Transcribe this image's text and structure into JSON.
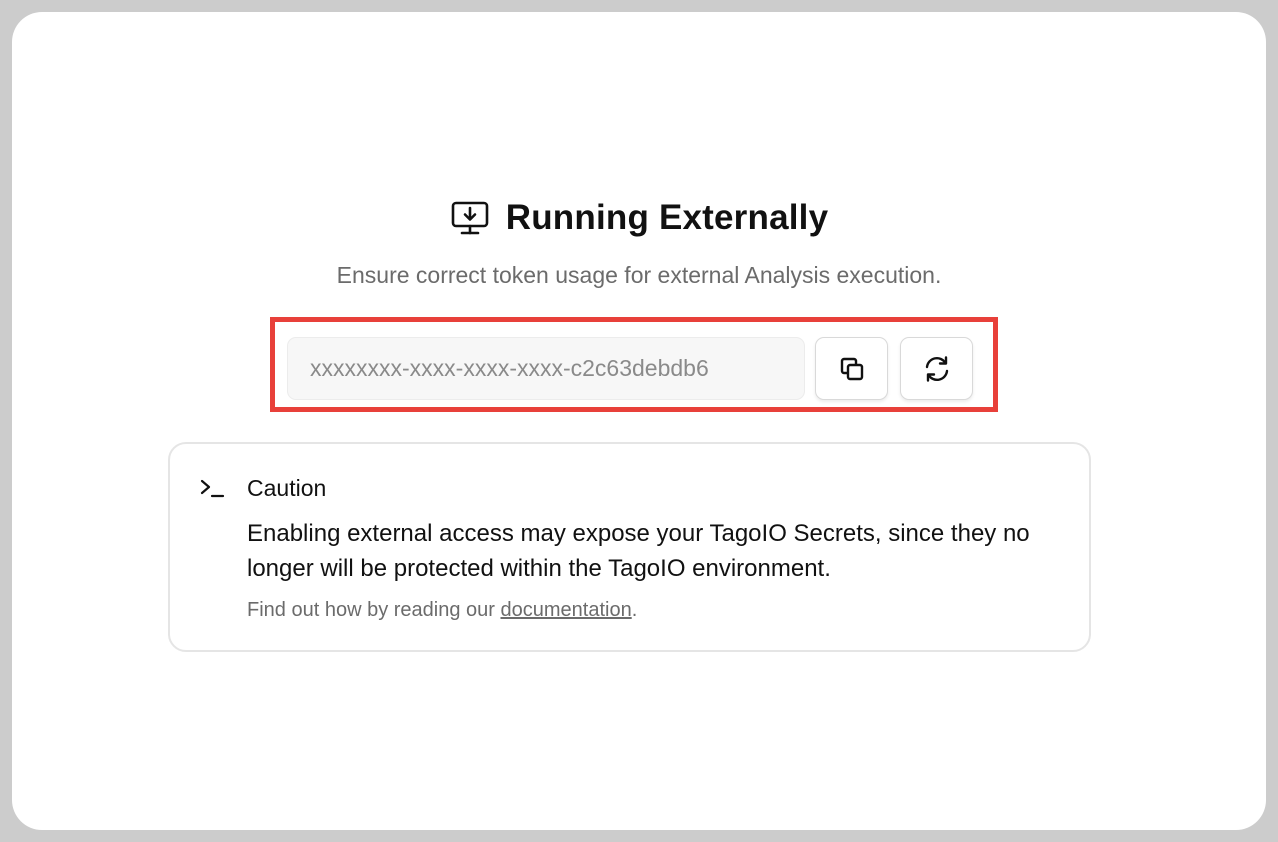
{
  "header": {
    "icon": "monitor-download-icon",
    "title": "Running Externally",
    "subtitle": "Ensure correct token usage for external Analysis execution."
  },
  "token": {
    "placeholder": "xxxxxxxx-xxxx-xxxx-xxxx-c2c63debdb6",
    "copy_icon": "copy-icon",
    "refresh_icon": "refresh-icon",
    "highlight_color": "#e8403a"
  },
  "caution": {
    "icon": "terminal-icon",
    "title": "Caution",
    "body": "Enabling external access may expose your TagoIO Secrets, since they no longer will be protected within the TagoIO environment.",
    "footer_prefix": "Find out how by reading our ",
    "footer_link": "documentation",
    "footer_suffix": "."
  }
}
